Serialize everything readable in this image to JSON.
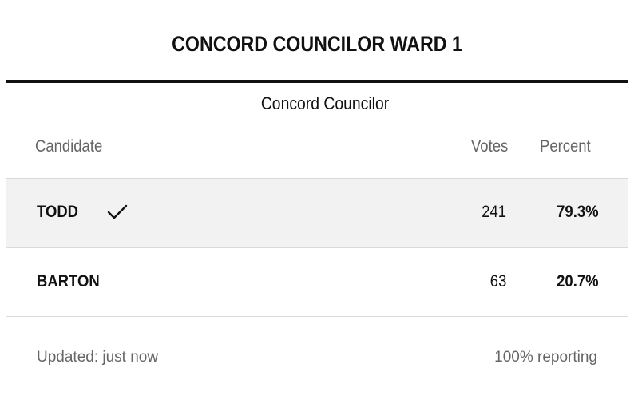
{
  "title": "CONCORD COUNCILOR WARD 1",
  "race_name": "Concord Councilor",
  "columns": {
    "candidate": "Candidate",
    "votes": "Votes",
    "percent": "Percent"
  },
  "candidates": [
    {
      "name": "TODD",
      "votes": "241",
      "percent": "79.3%",
      "winner": true
    },
    {
      "name": "BARTON",
      "votes": "63",
      "percent": "20.7%",
      "winner": false
    }
  ],
  "footer": {
    "updated": "Updated: just now",
    "reporting": "100% reporting"
  },
  "colors": {
    "text": "#111111",
    "muted": "#666666",
    "winner_row_bg": "#f2f2f2",
    "divider": "#d9d9d9"
  },
  "icons": {
    "winner_mark": "checkmark-icon"
  }
}
